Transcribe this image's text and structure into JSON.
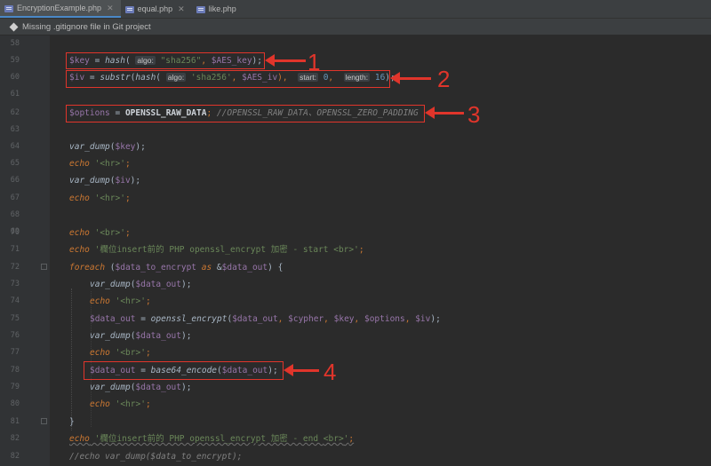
{
  "tabs": [
    {
      "label": "EncryptionExample.php",
      "icon": "php-file-icon",
      "active": true
    },
    {
      "label": "equal.php",
      "icon": "php-file-icon",
      "active": false
    },
    {
      "label": "like.php",
      "icon": "php-file-icon",
      "active": false
    }
  ],
  "banner": {
    "text": "Missing .gitignore file in Git project"
  },
  "lines": [
    {
      "n": "58"
    },
    {
      "n": "59"
    },
    {
      "n": "60"
    },
    {
      "n": "61"
    },
    {
      "n": "62"
    },
    {
      "n": "63"
    },
    {
      "n": "64"
    },
    {
      "n": "65"
    },
    {
      "n": "66"
    },
    {
      "n": "67"
    },
    {
      "n": "68"
    },
    {
      "n": "69"
    },
    {
      "n": "70"
    },
    {
      "n": "71"
    },
    {
      "n": "72"
    },
    {
      "n": "73"
    },
    {
      "n": "74"
    },
    {
      "n": "75"
    },
    {
      "n": "76"
    },
    {
      "n": "77"
    },
    {
      "n": "78"
    },
    {
      "n": "79"
    },
    {
      "n": "80"
    },
    {
      "n": "81"
    },
    {
      "n": "82"
    }
  ],
  "annotations": [
    "1",
    "2",
    "3",
    "4"
  ],
  "code": {
    "l59": {
      "v1": "$key",
      "eq": " = ",
      "fn": "hash",
      "p1": "( ",
      "hint": "algo:",
      "s1": " \"sha256\"",
      "c": ", ",
      "v2": "$AES_key",
      "end": ");"
    },
    "l60": {
      "v1": "$iv",
      "eq": " = ",
      "fn1": "substr",
      "p1": "(",
      "fn2": "hash",
      "p2": "( ",
      "hint1": "algo:",
      "s1": " 'sha256'",
      "c1": ", ",
      "v2": "$AES_iv",
      "c2": "),  ",
      "hint2": "start:",
      "n1": " 0",
      "c3": ",  ",
      "hint3": "length:",
      "n2": " 16",
      "end": ");"
    },
    "l62": {
      "v1": "$options",
      "eq": " = ",
      "const": "OPENSSL_RAW_DATA",
      "semi": "; ",
      "cmt": "//OPENSSL_RAW_DATA、OPENSSL_ZERO_PADDING"
    },
    "l64": {
      "fn": "var_dump",
      "p": "(",
      "v": "$key",
      "end": ");"
    },
    "l65": {
      "kw": "echo",
      "s": " '<hr>'",
      "end": ";"
    },
    "l66": {
      "fn": "var_dump",
      "p": "(",
      "v": "$iv",
      "end": ");"
    },
    "l67": {
      "kw": "echo",
      "s": " '<hr>'",
      "end": ";"
    },
    "l69": {
      "kw": "echo",
      "s": " '<br>'",
      "end": ";"
    },
    "l70": {
      "kw": "echo",
      "s": " '欄位insert前的 PHP openssl_encrypt 加密 - start <br>'",
      "end": ";"
    },
    "l71": {
      "kw": "foreach",
      "p": " (",
      "v1": "$data_to_encrypt",
      "as": " as ",
      "amp": "&",
      "v2": "$data_out",
      "end": ") {"
    },
    "l72": {
      "fn": "var_dump",
      "p": "(",
      "v": "$data_out",
      "end": ");"
    },
    "l73": {
      "kw": "echo",
      "s": " '<hr>'",
      "end": ";"
    },
    "l74": {
      "v1": "$data_out",
      "eq": " = ",
      "fn": "openssl_encrypt",
      "p": "(",
      "v2": "$data_out",
      "c1": ", ",
      "v3": "$cypher",
      "c2": ", ",
      "v4": "$key",
      "c3": ", ",
      "v5": "$options",
      "c4": ", ",
      "v6": "$iv",
      "end": ");"
    },
    "l75": {
      "fn": "var_dump",
      "p": "(",
      "v": "$data_out",
      "end": ");"
    },
    "l76": {
      "kw": "echo",
      "s": " '<br>'",
      "end": ";"
    },
    "l77": {
      "v1": "$data_out",
      "eq": " = ",
      "fn": "base64_encode",
      "p": "(",
      "v2": "$data_out",
      "end": ");"
    },
    "l78": {
      "fn": "var_dump",
      "p": "(",
      "v": "$data_out",
      "end": ");"
    },
    "l79": {
      "kw": "echo",
      "s": " '<hr>'",
      "end": ";"
    },
    "l80": {
      "brace": "}"
    },
    "l81": {
      "kw": "echo",
      "s1": " '欄位insert前的 PHP openssl_encrypt 加密 - end ",
      "s2": "<br>",
      "s3": "'",
      "end": ";"
    },
    "l82": {
      "cmt": "//echo var_dump($data_to_encrypt);"
    }
  }
}
